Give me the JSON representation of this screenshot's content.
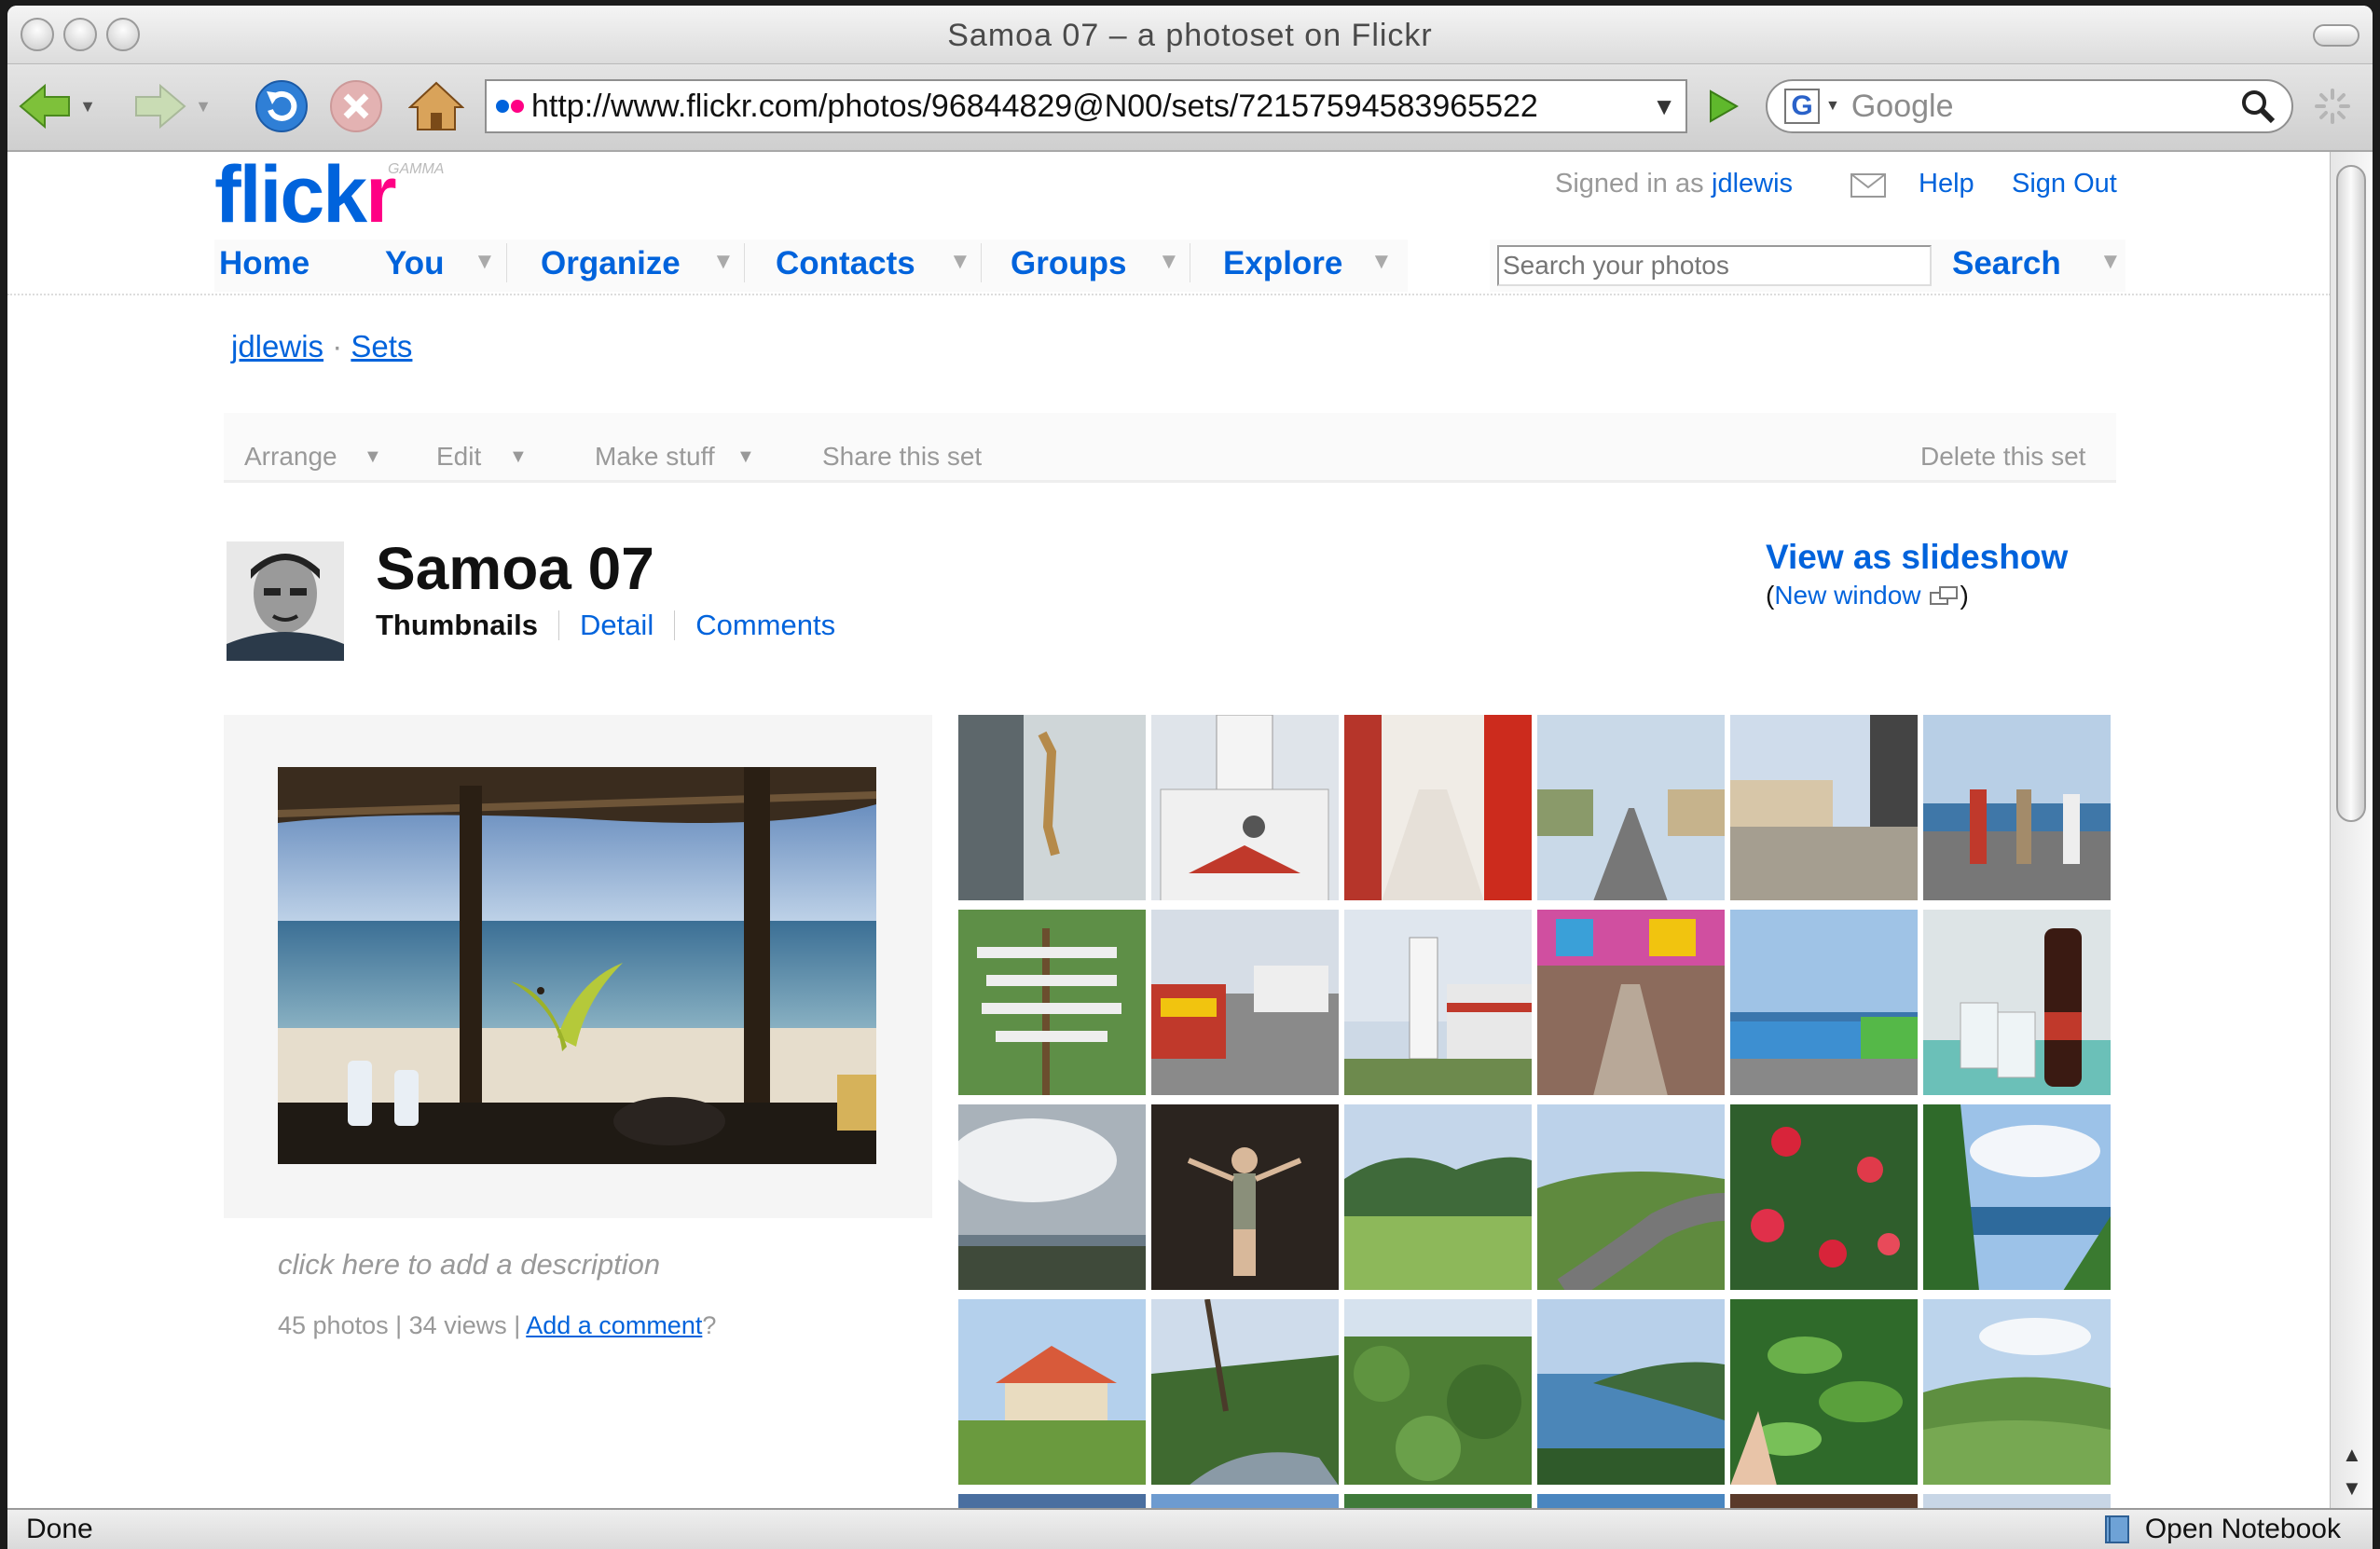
{
  "window": {
    "title": "Samoa 07 – a photoset on Flickr"
  },
  "browser": {
    "url": "http://www.flickr.com/photos/96844829@N00/sets/72157594583965522",
    "search_placeholder": "Google",
    "status": "Done",
    "notebook_label": "Open Notebook"
  },
  "flickr": {
    "logo_text": "flickr",
    "logo_badge": "GAMMA",
    "signed_in_prefix": "Signed in as",
    "username": "jdlewis",
    "help": "Help",
    "sign_out": "Sign Out",
    "nav": [
      "Home",
      "You",
      "Organize",
      "Contacts",
      "Groups",
      "Explore"
    ],
    "search_placeholder": "Search your photos",
    "search_button": "Search"
  },
  "breadcrumb": {
    "user": "jdlewis",
    "separator": "·",
    "section": "Sets"
  },
  "actions": {
    "arrange": "Arrange",
    "edit": "Edit",
    "make_stuff": "Make stuff",
    "share": "Share this set",
    "delete": "Delete this set"
  },
  "set": {
    "title": "Samoa 07",
    "views": {
      "thumbnails": "Thumbnails",
      "detail": "Detail",
      "comments": "Comments"
    },
    "slideshow": "View as slideshow",
    "new_window_open": "(",
    "new_window": "New window",
    "new_window_close": ")",
    "description_prompt": "click here to add a description",
    "photo_count": "45 photos",
    "view_count": "34 views",
    "sep": "|",
    "add_comment": "Add a comment",
    "add_comment_suffix": "?"
  },
  "thumbnails": [
    "gecko-on-wall",
    "white-church",
    "red-arched-arcade",
    "town-street",
    "roadside-shops",
    "three-men-seawall",
    "signpost-tree",
    "colorful-bus-street",
    "white-lighthouse",
    "market-stalls",
    "buses-by-harbor",
    "coke-bottle-glasses",
    "stormy-sky-bay",
    "woman-at-night",
    "green-field-hills",
    "winding-road",
    "red-flowers",
    "palms-over-sea",
    "red-roof-fale",
    "river-palms",
    "jungle-valley",
    "coastline-view",
    "leaves-closeup",
    "green-valley"
  ],
  "colors": {
    "link": "#0063dc",
    "flickr_blue": "#0063dc",
    "flickr_pink": "#ff0084",
    "muted": "#999999"
  }
}
